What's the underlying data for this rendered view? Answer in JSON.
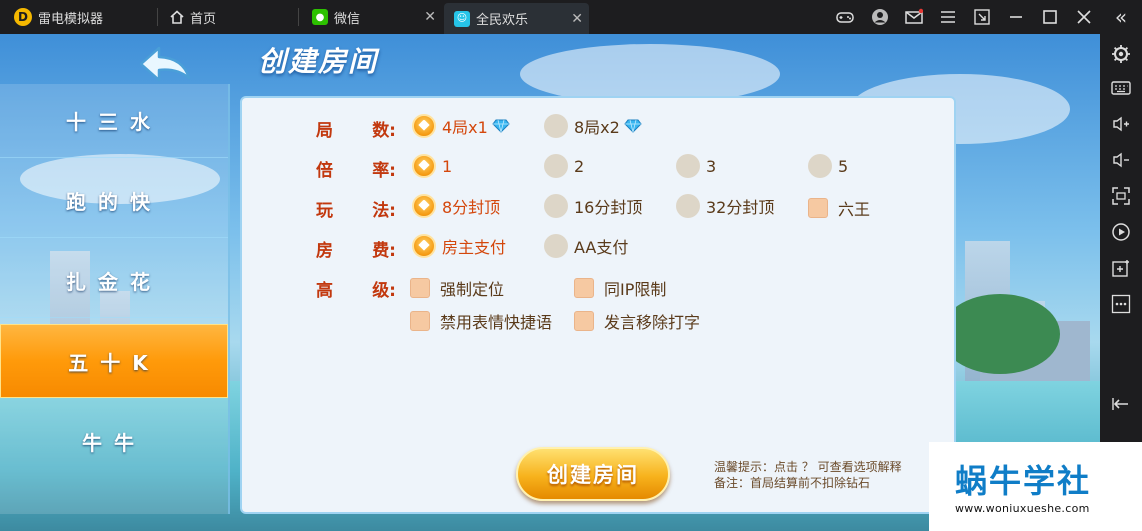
{
  "titlebar": {
    "app_name": "雷电模拟器",
    "tabs": [
      {
        "label": "首页",
        "closable": false
      },
      {
        "label": "微信",
        "closable": true
      },
      {
        "label": "全民欢乐",
        "closable": true,
        "active": true
      }
    ],
    "close_glyph": "✕",
    "window_controls": [
      "gamepad-icon",
      "user-icon",
      "mail-icon",
      "menu-icon",
      "resize-icon",
      "minimize-icon",
      "maximize-icon",
      "close-icon"
    ],
    "expand_glyph": "«"
  },
  "sidebar_right": {
    "icons": [
      "settings-icon",
      "keyboard-icon",
      "volume-up-icon",
      "volume-down-icon",
      "fullscreen-icon",
      "record-icon",
      "install-apk-icon",
      "more-icon",
      "back-icon"
    ]
  },
  "game": {
    "page_title": "创建房间",
    "menu": [
      {
        "label": "十三水"
      },
      {
        "label": "跑的快"
      },
      {
        "label": "扎金花"
      },
      {
        "label": "五十K",
        "active": true
      },
      {
        "label": "牛牛"
      }
    ],
    "rows": [
      {
        "label_a": "局",
        "label_b": "数:",
        "type": "radio",
        "options": [
          {
            "text": "4局x1",
            "selected": true,
            "gem": true
          },
          {
            "text": "8局x2",
            "selected": false,
            "gem": true
          }
        ]
      },
      {
        "label_a": "倍",
        "label_b": "率:",
        "type": "radio",
        "options": [
          {
            "text": "1",
            "selected": true
          },
          {
            "text": "2",
            "selected": false
          },
          {
            "text": "3",
            "selected": false
          },
          {
            "text": "5",
            "selected": false
          }
        ]
      },
      {
        "label_a": "玩",
        "label_b": "法:",
        "type": "radio",
        "options": [
          {
            "text": "8分封顶",
            "selected": true
          },
          {
            "text": "16分封顶",
            "selected": false
          },
          {
            "text": "32分封顶",
            "selected": false
          },
          {
            "text": "六王",
            "selected": false,
            "checkbox": true
          }
        ]
      },
      {
        "label_a": "房",
        "label_b": "费:",
        "type": "radio",
        "options": [
          {
            "text": "房主支付",
            "selected": true
          },
          {
            "text": "AA支付",
            "selected": false
          }
        ]
      },
      {
        "label_a": "高",
        "label_b": "级:",
        "type": "checkbox",
        "options": [
          {
            "text": "强制定位",
            "checked": false
          },
          {
            "text": "同IP限制",
            "checked": false
          },
          {
            "text": "禁用表情快捷语",
            "checked": false
          },
          {
            "text": "发言移除打字",
            "checked": false
          }
        ]
      }
    ],
    "create_button": "创建房间",
    "tip_line1": "温馨提示：点击 ？ 可查看选项解释",
    "tip_line2": "备注：首局结算前不扣除钻石"
  },
  "watermark": {
    "title": "蜗牛学社",
    "url": "www.woniuxueshe.com"
  },
  "colors": {
    "accent_orange": "#f7a020",
    "label_red": "#c2380e",
    "panel_bg": "#eef4fa",
    "watermark_blue": "#0f7dc7"
  }
}
